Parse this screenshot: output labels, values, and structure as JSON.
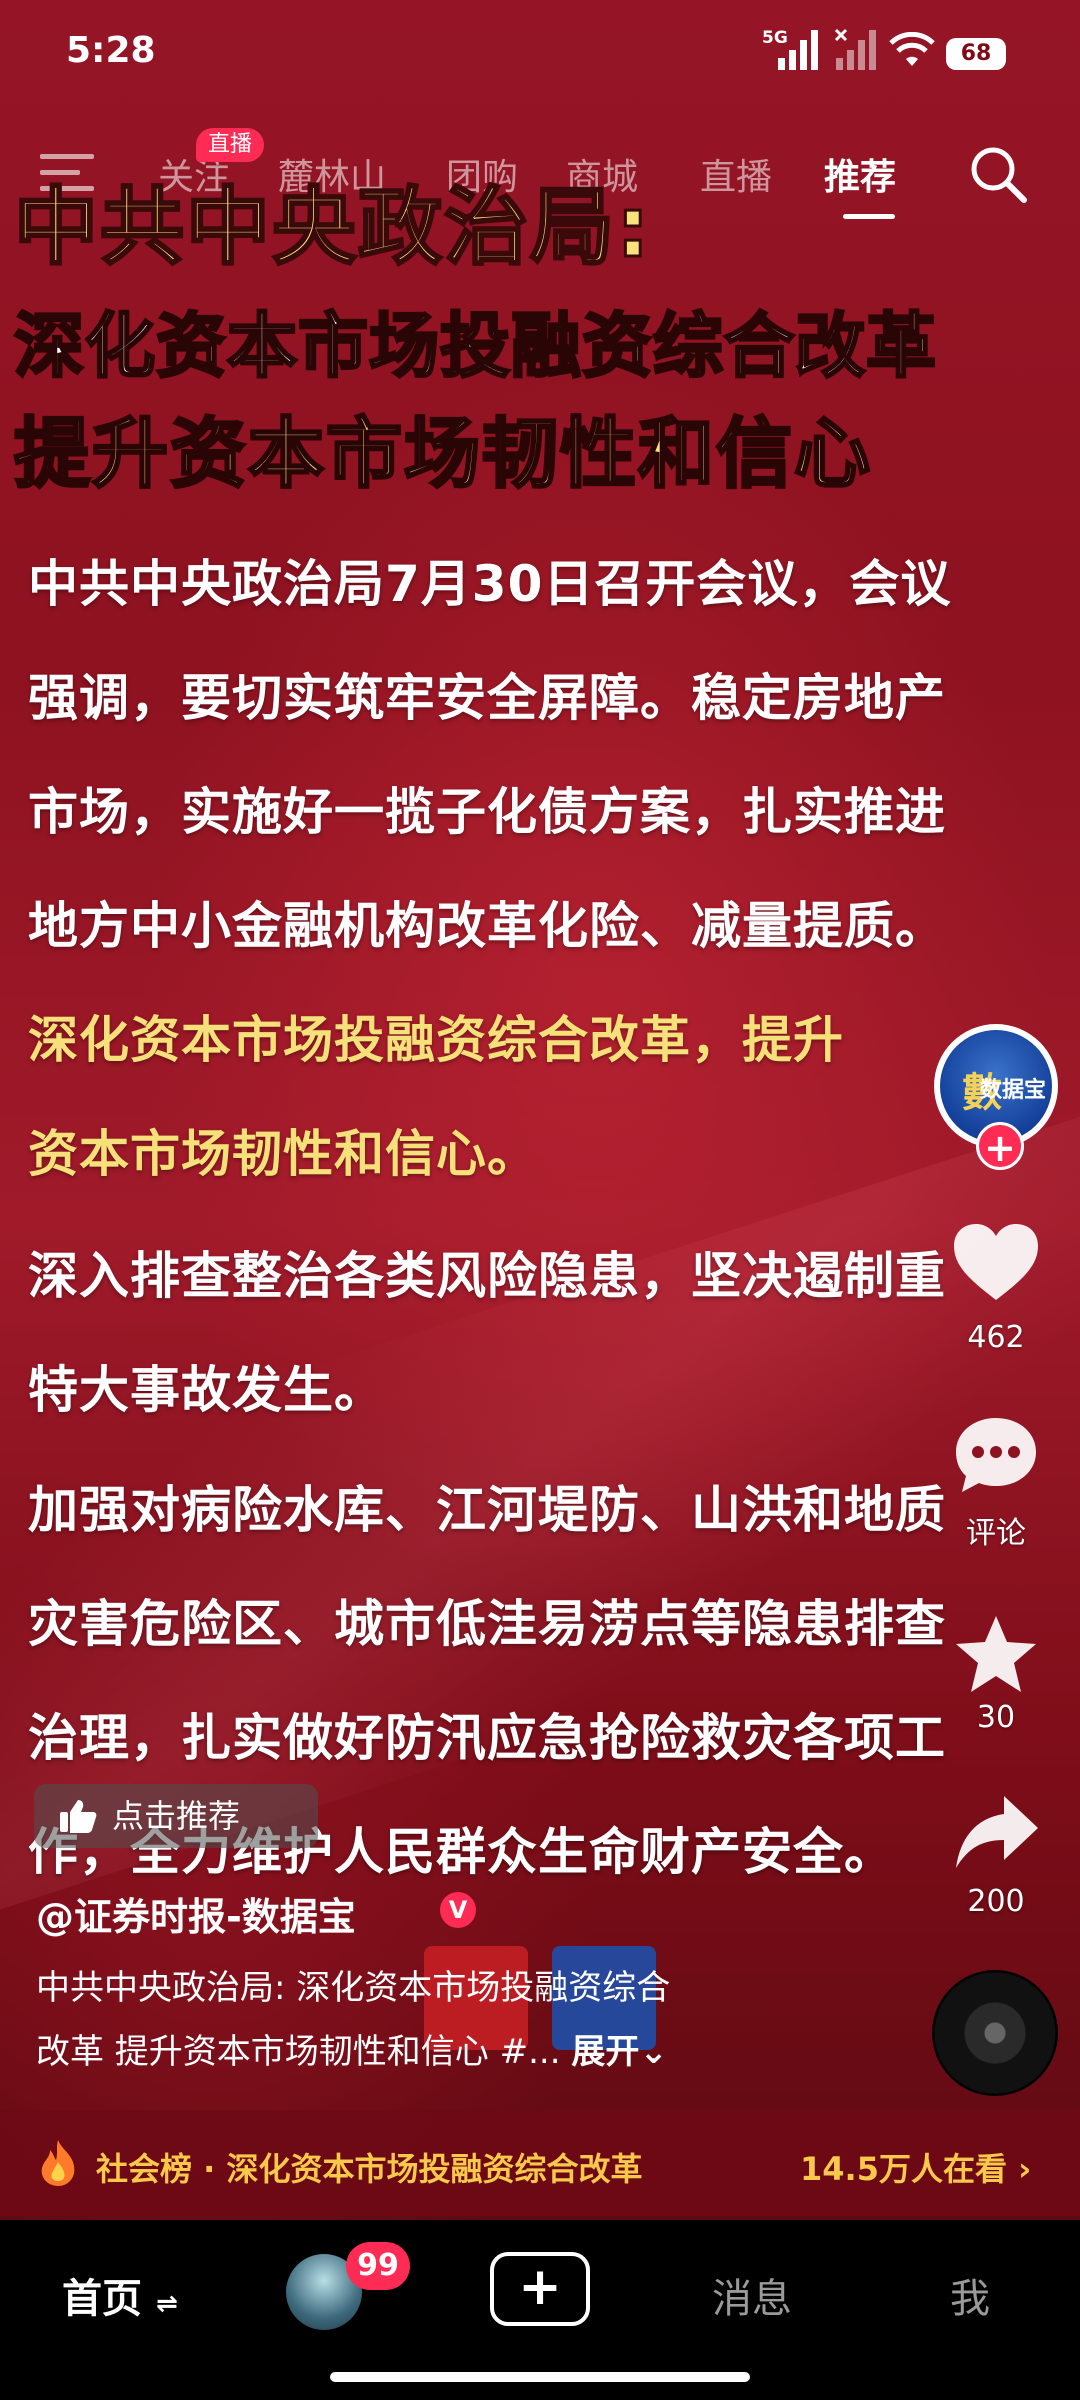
{
  "status_bar": {
    "time": "5:28",
    "network": "5G",
    "battery": "68"
  },
  "top_nav": {
    "live_badge": "直播",
    "tabs": [
      "关注",
      "麓林山",
      "团购",
      "商城",
      "直播",
      "推荐"
    ],
    "active_tab": "推荐"
  },
  "post": {
    "headline_1": "中共中央政治局:",
    "headline_2": "深化资本市场投融资综合改革",
    "headline_3": "提升资本市场韧性和信心",
    "body_lines": [
      {
        "text": "中共中央政治局7月30日召开会议，会议",
        "highlight": false
      },
      {
        "text": "强调，要切实筑牢安全屏障。稳定房地产",
        "highlight": false
      },
      {
        "text": "市场，实施好一揽子化债方案，扎实推进",
        "highlight": false
      },
      {
        "text": "地方中小金融机构改革化险、减量提质。",
        "highlight": false
      },
      {
        "text": "深化资本市场投融资综合改革，提升",
        "highlight": true
      },
      {
        "text": "资本市场韧性和信心。",
        "highlight": true
      },
      {
        "text": "深入排查整治各类风险隐患，坚决遏制重",
        "highlight": false
      },
      {
        "text": "特大事故发生。",
        "highlight": false
      },
      {
        "text": "加强对病险水库、江河堤防、山洪和地质",
        "highlight": false
      },
      {
        "text": "灾害危险区、城市低洼易涝点等隐患排查",
        "highlight": false
      },
      {
        "text": "治理，扎实做好防汛应急抢险救灾各项工",
        "highlight": false
      },
      {
        "text": "作，全力维护人民群众生命财产安全。",
        "highlight": false
      }
    ]
  },
  "right_rail": {
    "avatar_text": "数据宝",
    "likes": "462",
    "comments_label": "评论",
    "favorites": "30",
    "shares": "200"
  },
  "recommend_chip": {
    "label": "点击推荐"
  },
  "author": {
    "handle": "@证券时报-数据宝",
    "verified": "V"
  },
  "description": {
    "line_1": "中共中央政治局: 深化资本市场投融资综合",
    "line_2": "改革 提升资本市场韧性和信心 #...",
    "expand_label": "展开"
  },
  "hot_bar": {
    "label": "社会榜 · 深化资本市场投融资综合改革",
    "viewers": "14.5万人在看"
  },
  "bottom_nav": {
    "home": "首页",
    "badge": "99",
    "messages": "消息",
    "me": "我"
  },
  "colors": {
    "accent_red": "#fe2c55",
    "headline_yellow": "#f8e27b",
    "hot_gold": "#f7c84a"
  }
}
